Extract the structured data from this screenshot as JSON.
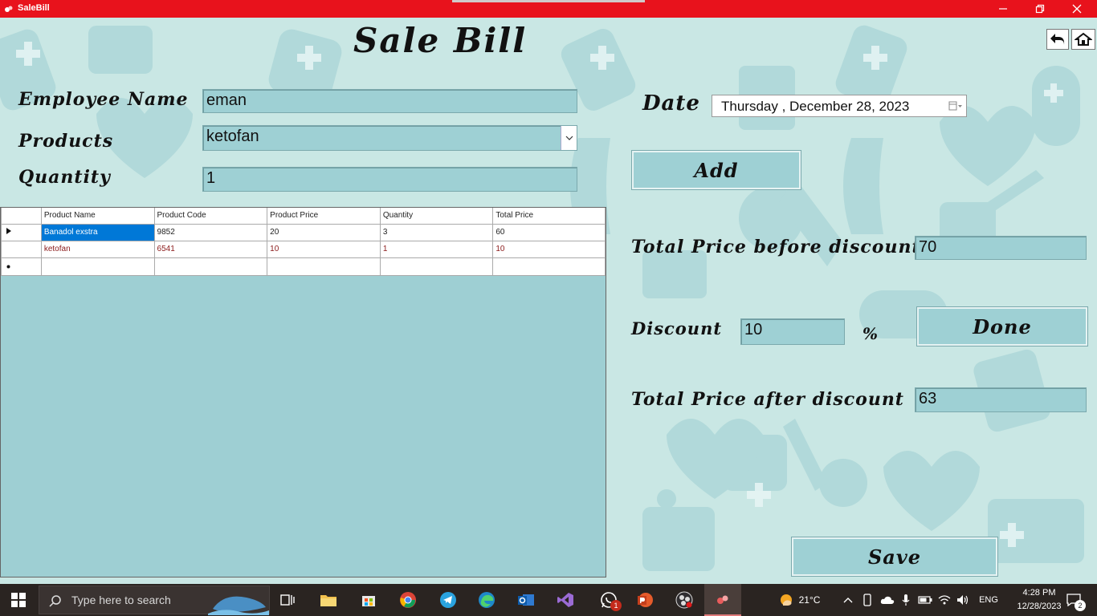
{
  "window": {
    "title": "SaleBill"
  },
  "form": {
    "heading": "Sale Bill",
    "employee_label": "Employee Name",
    "employee_value": "eman",
    "products_label": "Products",
    "products_value": "ketofan",
    "quantity_label": "Quantity",
    "quantity_value": "1",
    "date_label": "Date",
    "date_value": "Thursday  , December 28, 2023",
    "add_label": "Add",
    "total_before_label": "Total Price before discount",
    "total_before_value": "70",
    "discount_label": "Discount",
    "discount_value": "10",
    "percent_sign": "%",
    "done_label": "Done",
    "total_after_label": "Total Price after discount",
    "total_after_value": "63",
    "save_label": "Save"
  },
  "grid": {
    "columns": [
      "Product Name",
      "Product Code",
      "Product Price",
      "Quantity",
      "Total Price"
    ],
    "rows": [
      [
        "Banadol exstra",
        "9852",
        "20",
        "3",
        "60"
      ],
      [
        "ketofan",
        "6541",
        "10",
        "1",
        "10"
      ]
    ]
  },
  "taskbar": {
    "search_placeholder": "Type here to search",
    "weather": "21°C",
    "language": "ENG",
    "time": "4:28 PM",
    "date": "12/28/2023",
    "whatsapp_badge": "1",
    "notifications_badge": "2"
  },
  "colors": {
    "titlebar": "#e8121c",
    "panel": "#9ed0d4",
    "background": "#c9e7e4",
    "selection": "#0078d7"
  }
}
